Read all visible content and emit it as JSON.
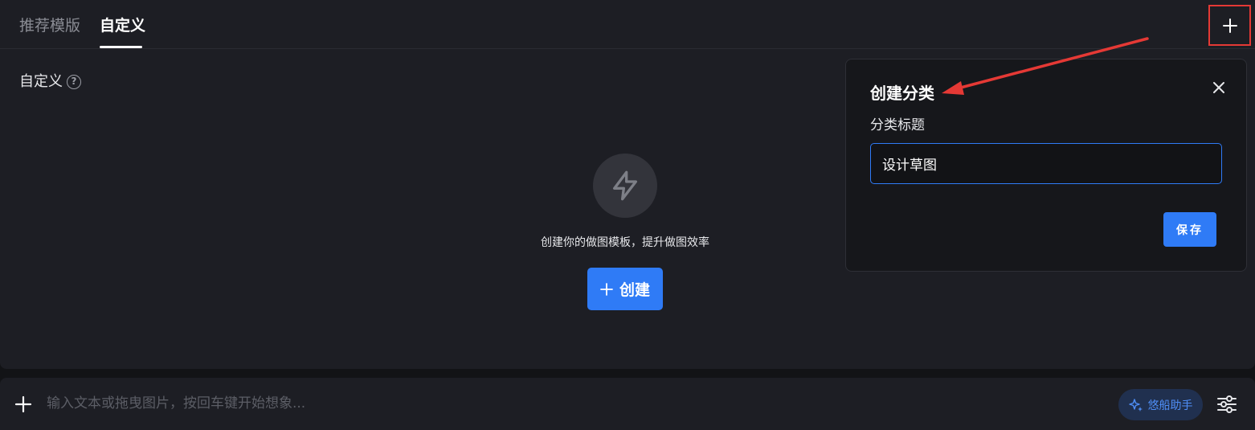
{
  "tabs": [
    {
      "label": "推荐模版",
      "active": false
    },
    {
      "label": "自定义",
      "active": true
    }
  ],
  "section": {
    "title": "自定义",
    "help_icon": "question-circle-icon"
  },
  "empty_state": {
    "icon": "lightning-icon",
    "text": "创建你的做图模板，提升做图效率",
    "create_label": "创建"
  },
  "popover": {
    "title": "创建分类",
    "field_label": "分类标题",
    "input_value": "设计草图",
    "save_label": "保存"
  },
  "input_bar": {
    "placeholder": "输入文本或拖曳图片，按回车键开始想象...",
    "assistant_label": "悠船助手"
  },
  "colors": {
    "accent": "#2f7bf6",
    "highlight": "#e53935",
    "panel": "#1d1e24",
    "background": "#121316"
  }
}
